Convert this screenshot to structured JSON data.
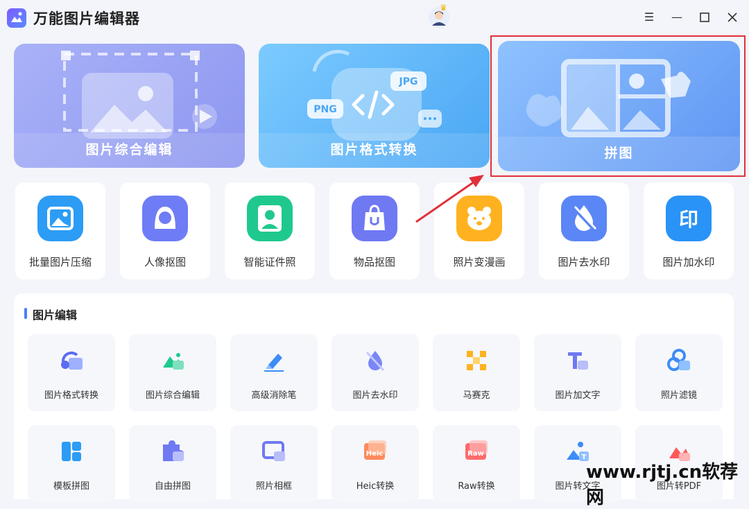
{
  "app": {
    "title": "万能图片编辑器"
  },
  "feature_cards": [
    {
      "label": "图片综合编辑"
    },
    {
      "label": "图片格式转换",
      "badge_png": "PNG",
      "badge_jpg": "JPG"
    },
    {
      "label": "拼图"
    }
  ],
  "tools": [
    {
      "label": "批量图片压缩",
      "color": "#2d9cf5"
    },
    {
      "label": "人像抠图",
      "color": "#6e7df5"
    },
    {
      "label": "智能证件照",
      "color": "#1fc98d"
    },
    {
      "label": "物品抠图",
      "color": "#6f79f2"
    },
    {
      "label": "照片变漫画",
      "color": "#ffb21f"
    },
    {
      "label": "图片去水印",
      "color": "#5b86f6"
    },
    {
      "label": "图片加水印",
      "color": "#2a93f7",
      "glyph": "印"
    }
  ],
  "editing": {
    "section_title": "图片编辑",
    "row1": [
      {
        "label": "图片格式转换"
      },
      {
        "label": "图片综合编辑"
      },
      {
        "label": "高级消除笔"
      },
      {
        "label": "图片去水印"
      },
      {
        "label": "马赛克"
      },
      {
        "label": "图片加文字"
      },
      {
        "label": "照片滤镜"
      }
    ],
    "row2": [
      {
        "label": "模板拼图"
      },
      {
        "label": "自由拼图"
      },
      {
        "label": "照片相框"
      },
      {
        "label": "Heic转换",
        "badge": "Heic"
      },
      {
        "label": "Raw转换",
        "badge": "Raw"
      },
      {
        "label": "图片转文字"
      },
      {
        "label": "图片转PDF"
      }
    ]
  },
  "watermark": "www.rjtj.cn软荐网",
  "colors": {
    "accent": "#4c7dfb",
    "highlight": "#e0303a"
  }
}
